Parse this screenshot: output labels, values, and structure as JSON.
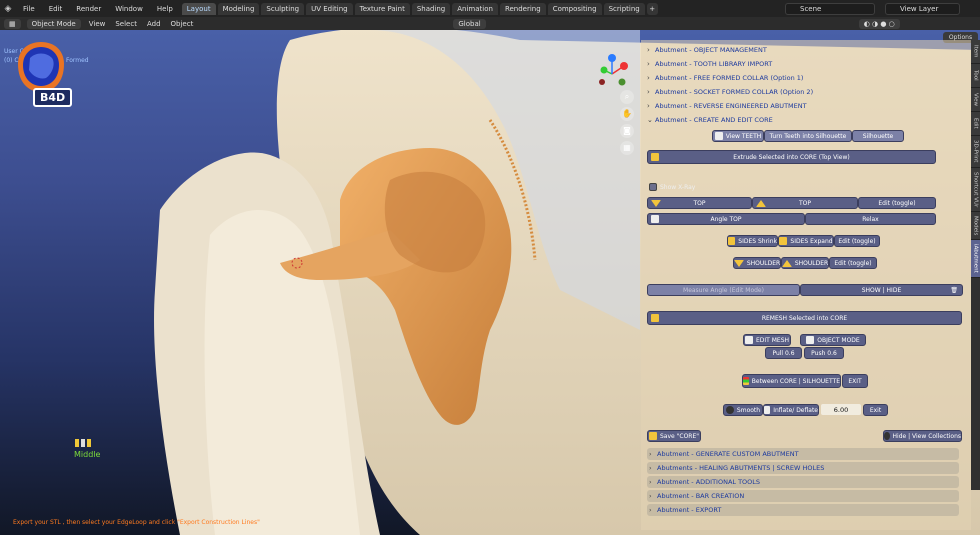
{
  "menu": {
    "logo_icon": "blender-icon",
    "items": [
      "File",
      "Edit",
      "Render",
      "Window",
      "Help"
    ]
  },
  "workspaces": [
    "Layout",
    "Modeling",
    "Sculpting",
    "UV Editing",
    "Texture Paint",
    "Shading",
    "Animation",
    "Rendering",
    "Compositing",
    "Scripting"
  ],
  "workspace_add": "+",
  "scene": {
    "name": "Scene",
    "view_layer": "View Layer"
  },
  "header": {
    "mode": "Object Mode",
    "menus": [
      "View",
      "Select",
      "Add",
      "Object"
    ],
    "orientation": "Global",
    "options": "Options"
  },
  "viewport": {
    "overlay_line1": "User O",
    "overlay_line2": "(0) C",
    "overlay_line3": "Formed",
    "logo_text": "B4D",
    "mouse_label": "Middle",
    "status": "Export your STL , then select your EdgeLoop and click \"Export Construction Lines\""
  },
  "panel": {
    "sections_top": [
      "Abutment - OBJECT MANAGEMENT",
      "Abutment - TOOTH LIBRARY IMPORT",
      "Abutment - FREE FORMED COLLAR (Option 1)",
      "Abutment - SOCKET FORMED COLLAR (Option 2)",
      "Abutment - REVERSE ENGINEERED ABUTMENT",
      "Abutment - CREATE AND EDIT CORE"
    ],
    "view_teeth": "View TEETH",
    "turn_teeth": "Turn Teeth into Silhouette",
    "silhouette": "Silhouette",
    "extrude": "Extrude Selected into CORE (Top View)",
    "show_xray": "Show X-Ray",
    "top1": "TOP",
    "top2": "TOP",
    "edit_toggle": "Edit (toggle)",
    "angle_top": "Angle TOP",
    "relax": "Relax",
    "sides_shrink": "SIDES Shrink",
    "sides_expand": "SIDES Expand",
    "edit_toggle2": "Edit (toggle)",
    "shoulder1": "SHOULDER",
    "shoulder2": "SHOULDER",
    "edit_toggle3": "Edit (toggle)",
    "measure_angle": "Measure Angle (Edit Mode)",
    "show_hide": "SHOW | HIDE",
    "remesh": "REMESH Selected into CORE",
    "edit_mesh": "EDIT MESH",
    "object_mode": "OBJECT MODE",
    "pull": "Pull 0.6",
    "push": "Push 0.6",
    "between": "Between CORE | SILHOUETTE",
    "exit1": "EXIT",
    "smooth": "Smooth",
    "inflate": "Inflate/ Deflate",
    "inflate_value": "6.00",
    "exit2": "Exit",
    "save_core": "Save \"CORE\"",
    "hide_view": "Hide | View Collections",
    "sections_bottom": [
      "Abutment - GENERATE CUSTOM ABUTMENT",
      "Abutments - HEALING ABUTMENTS | SCREW HOLES",
      "Abutment - ADDITIONAL TOOLS",
      "Abutment - BAR CREATION",
      "Abutment - EXPORT"
    ]
  },
  "side_tabs": [
    "Item",
    "Tool",
    "View",
    "Edit",
    "3D-Print",
    "Shortcut VUr",
    "Models",
    "iAbutment"
  ],
  "colors": {
    "accent_panel": "#5a5f86",
    "section_text": "#1d3a9e",
    "core_orange": "#e6a257"
  }
}
